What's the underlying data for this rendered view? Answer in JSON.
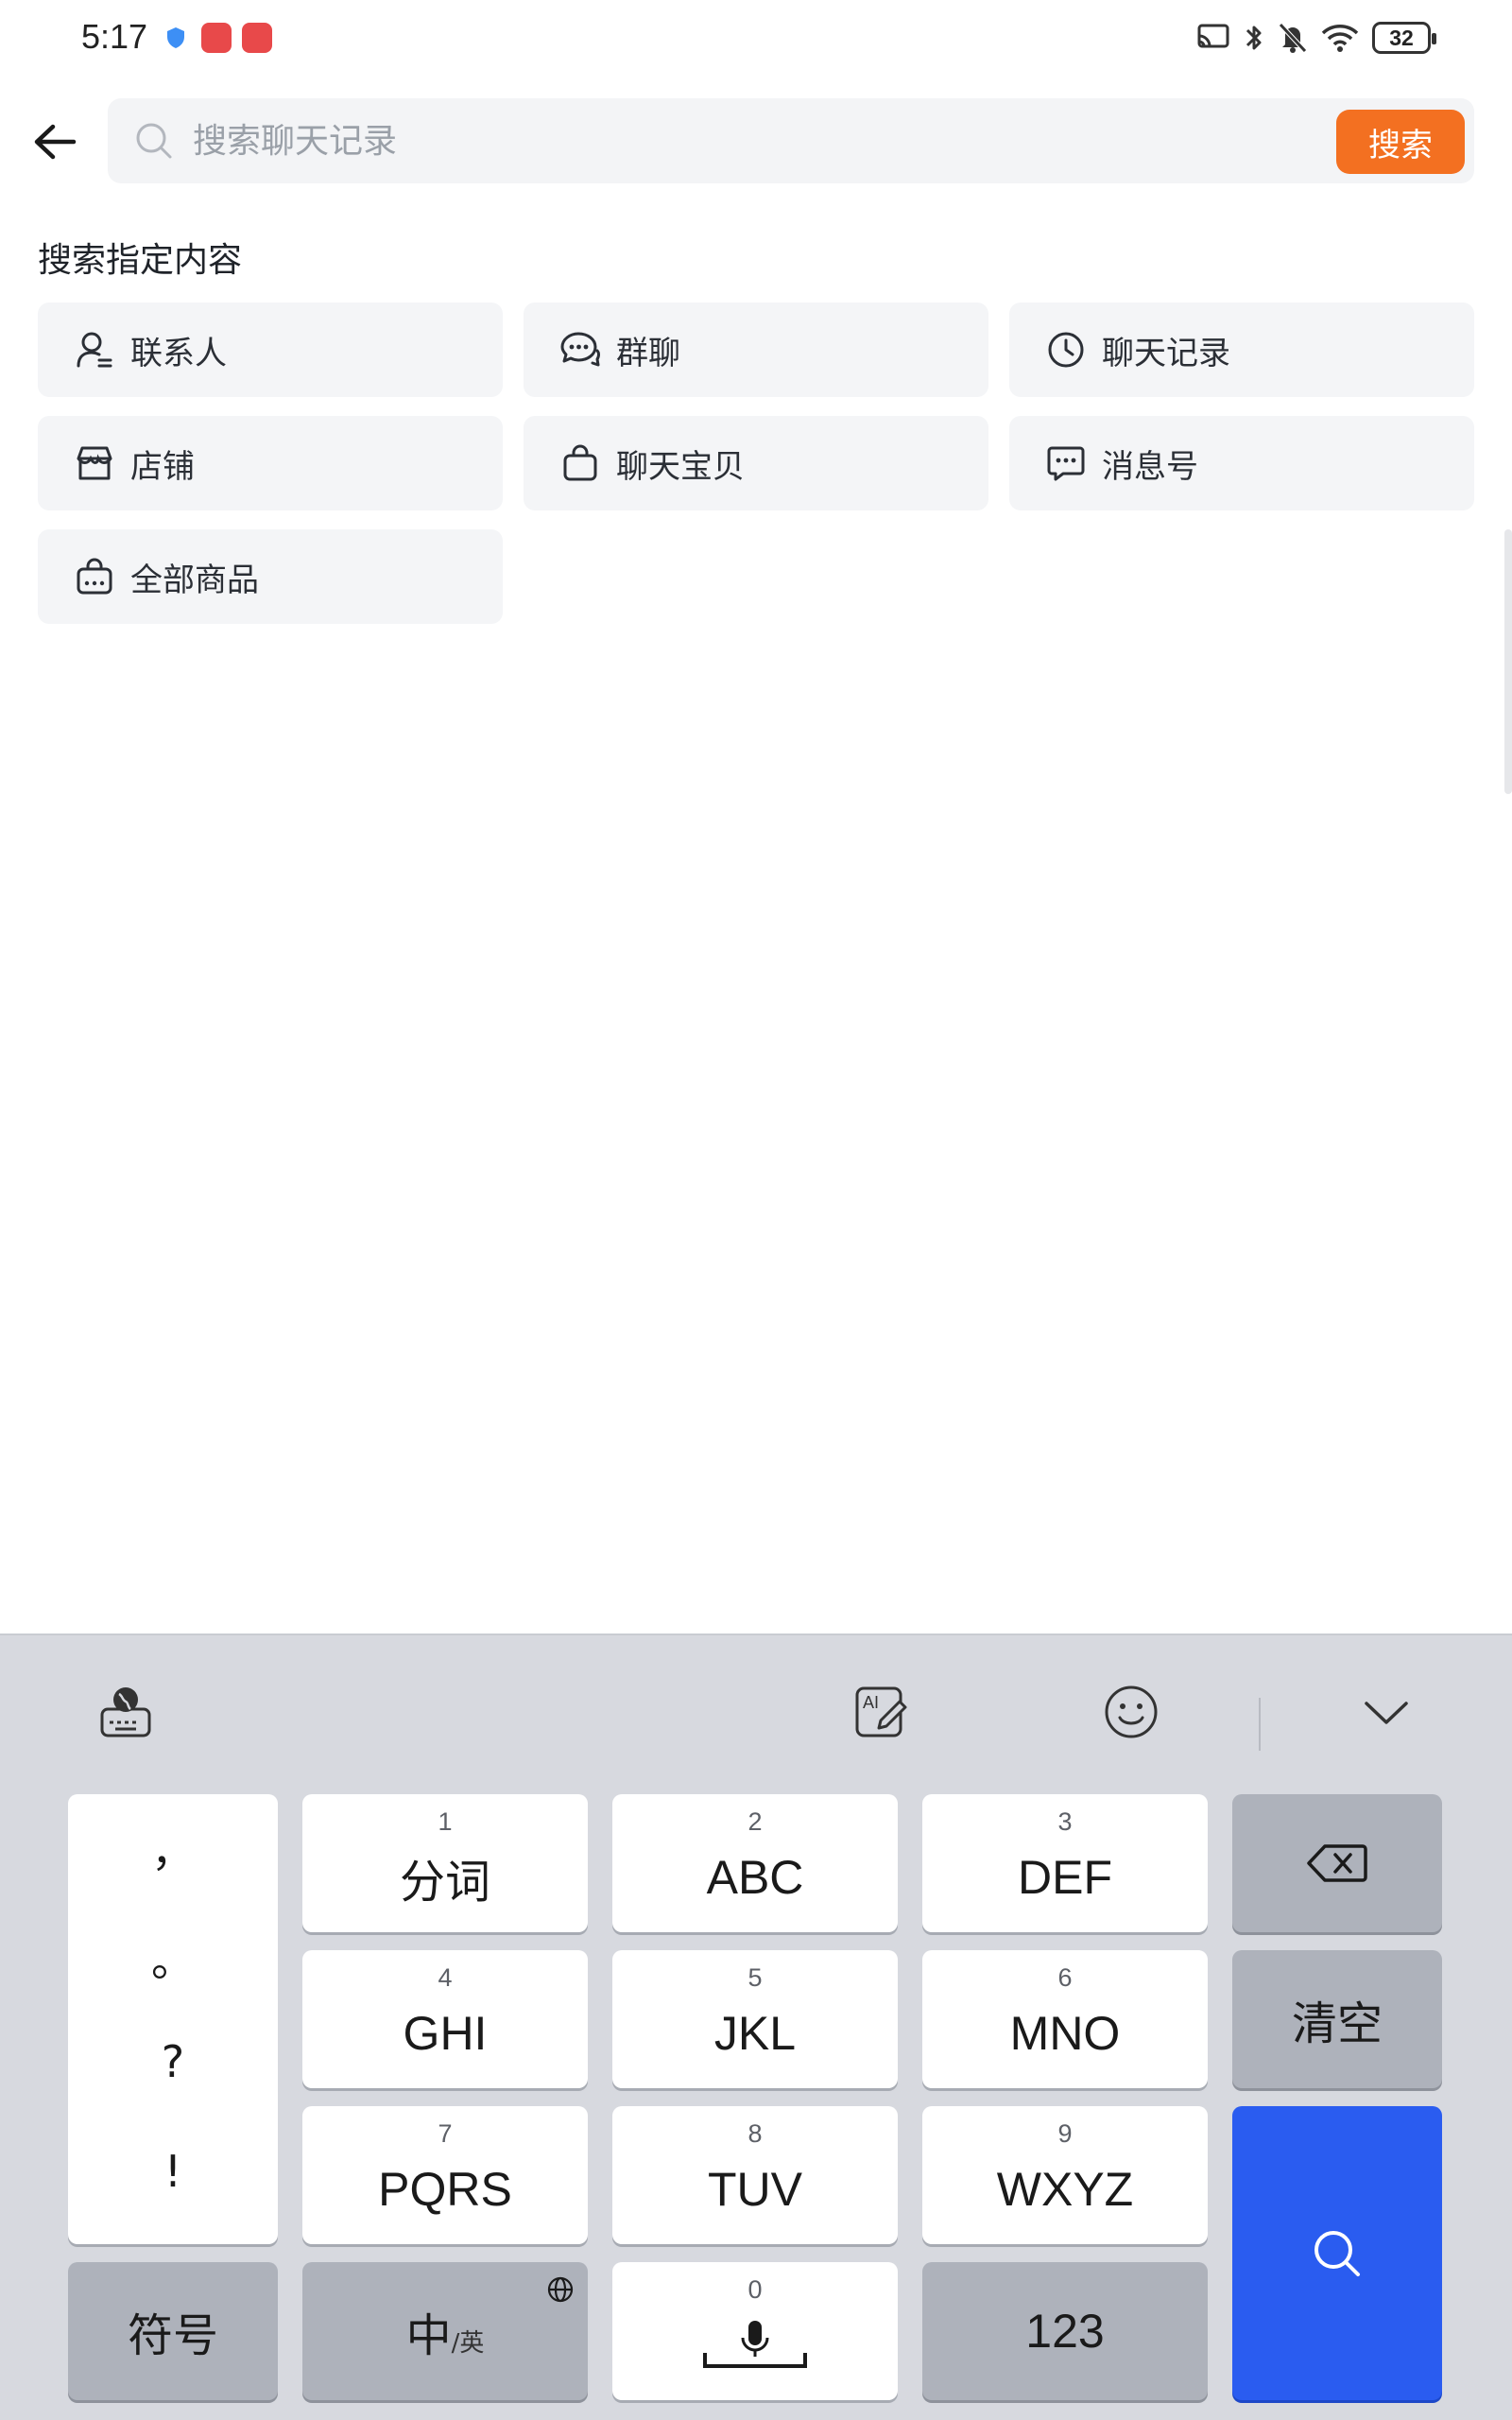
{
  "status_bar": {
    "time": "5:17",
    "battery": "32",
    "icons": [
      "shield-icon",
      "app-notification-icon",
      "app-notification-icon",
      "cast-icon",
      "bluetooth-icon",
      "mute-icon",
      "wifi-icon",
      "battery-icon"
    ]
  },
  "search": {
    "placeholder": "搜索聊天记录",
    "value": "",
    "button_label": "搜索",
    "accent_color": "#f37021"
  },
  "section": {
    "title": "搜索指定内容",
    "items": [
      {
        "label": "联系人",
        "icon": "contact-icon"
      },
      {
        "label": "群聊",
        "icon": "group-chat-icon"
      },
      {
        "label": "聊天记录",
        "icon": "clock-icon"
      },
      {
        "label": "店铺",
        "icon": "store-icon"
      },
      {
        "label": "聊天宝贝",
        "icon": "bag-icon"
      },
      {
        "label": "消息号",
        "icon": "message-icon"
      },
      {
        "label": "全部商品",
        "icon": "shopping-bag-icon"
      }
    ]
  },
  "keyboard": {
    "toolbar": [
      "keyboard-globe-icon",
      "ai-write-icon",
      "emoji-icon",
      "collapse-icon"
    ],
    "punctuation": [
      "，",
      "。",
      "?",
      "!"
    ],
    "keys": [
      {
        "num": "1",
        "label": "分词"
      },
      {
        "num": "2",
        "label": "ABC"
      },
      {
        "num": "3",
        "label": "DEF"
      },
      {
        "num": "4",
        "label": "GHI"
      },
      {
        "num": "5",
        "label": "JKL"
      },
      {
        "num": "6",
        "label": "MNO"
      },
      {
        "num": "7",
        "label": "PQRS"
      },
      {
        "num": "8",
        "label": "TUV"
      },
      {
        "num": "9",
        "label": "WXYZ"
      },
      {
        "num": "0",
        "label": ""
      }
    ],
    "clear_label": "清空",
    "symbols_label": "符号",
    "lang_main": "中",
    "lang_sub": "/英",
    "numbers_label": "123",
    "search_key_color": "#2a5cf0"
  }
}
